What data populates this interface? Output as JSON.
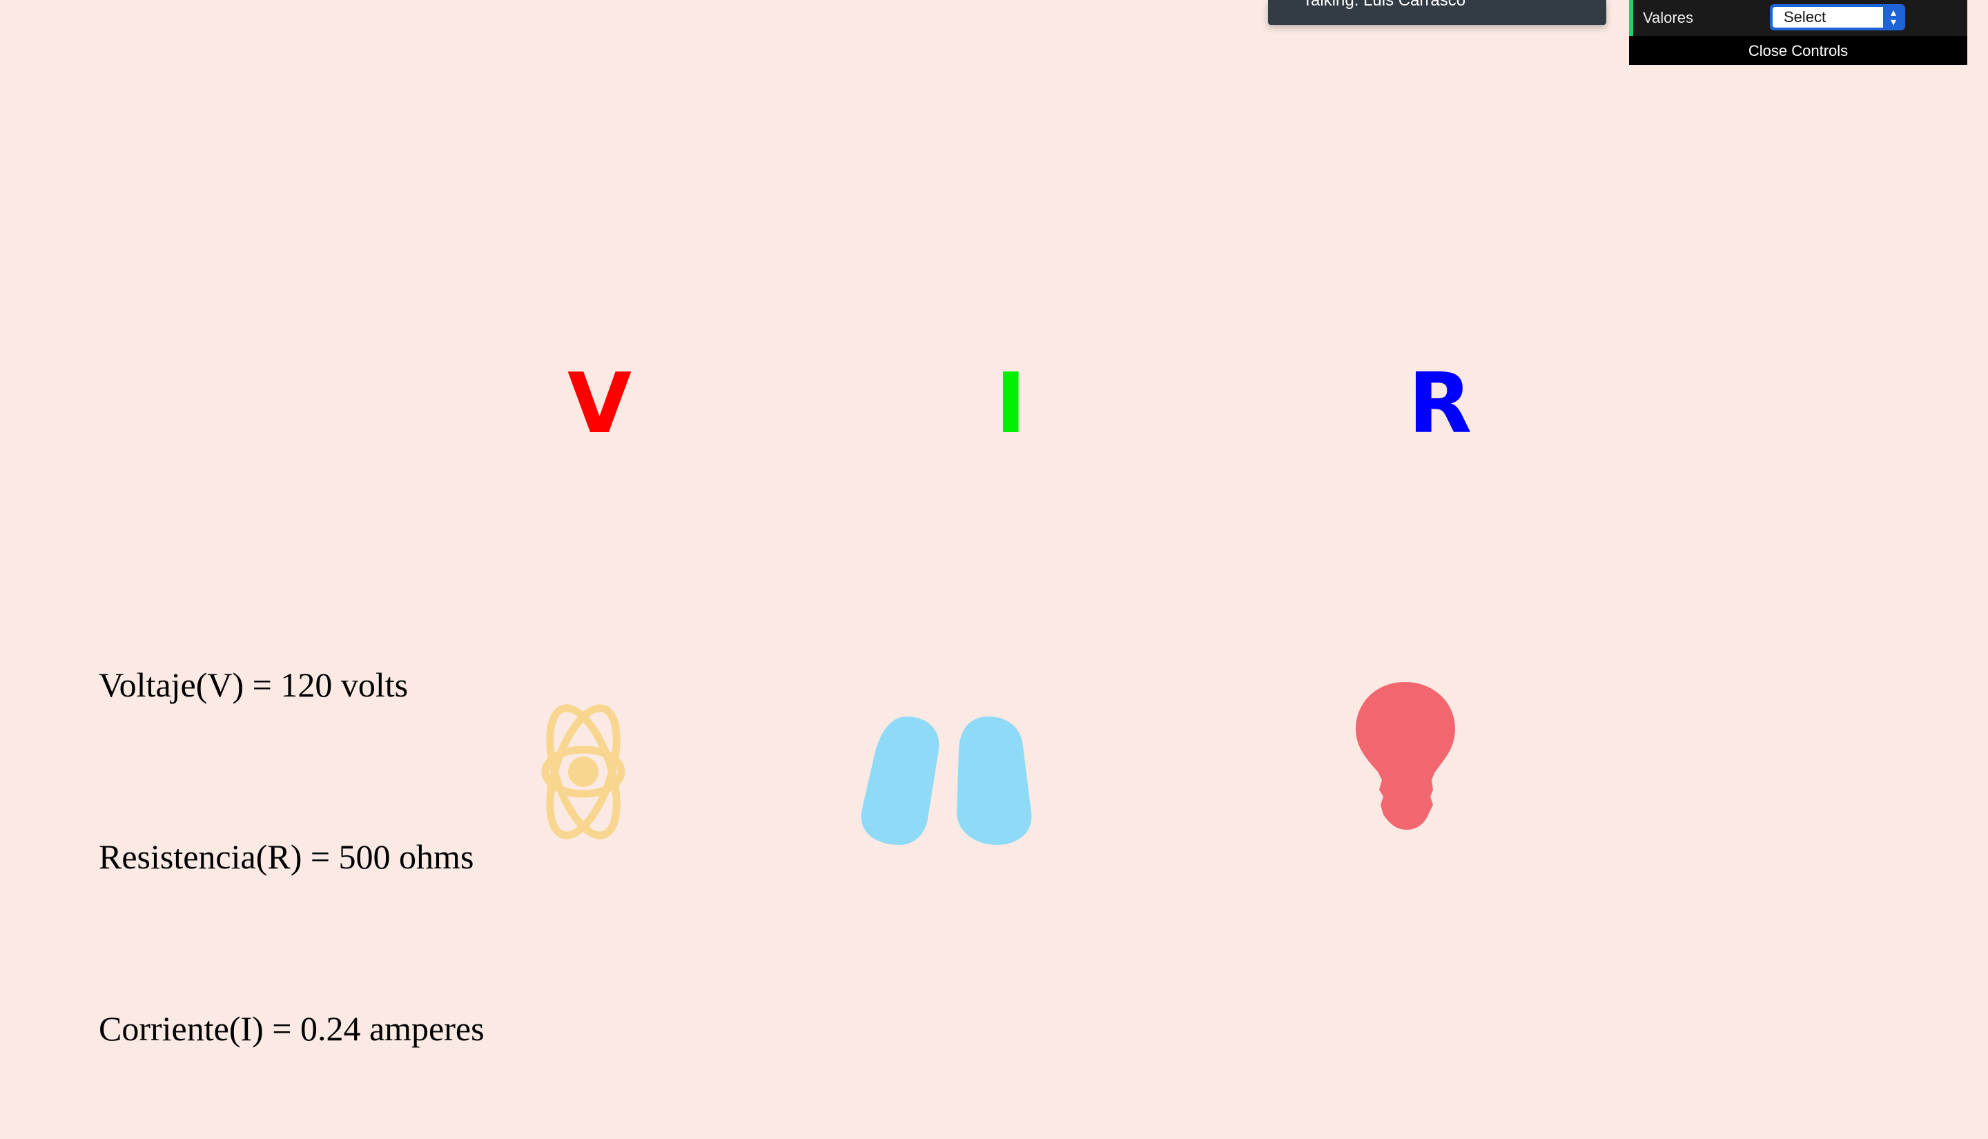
{
  "notification": {
    "text": "Talking: Luis Carrasco"
  },
  "controls": {
    "row_label": "Valores",
    "select_value": "Select",
    "close_label": "Close Controls"
  },
  "letters": {
    "v": "V",
    "i": "I",
    "r": "R"
  },
  "values": {
    "voltage": "Voltaje(V) = 120 volts",
    "resistance": "Resistencia(R) = 500 ohms",
    "current": "Corriente(I) = 0.24 amperes"
  },
  "colors": {
    "background": "#fbeae3",
    "letter_v": "#ff0000",
    "letter_i": "#00ee00",
    "letter_r": "#0000ff",
    "atom": "#f8d68f",
    "pill": "#8fdaf6",
    "bulb": "#f2676f"
  },
  "icons": {
    "atom": "atom-icon",
    "pill": "pill-icon",
    "bulb": "lightbulb-icon",
    "select_arrow": "up-down-chevron-icon"
  }
}
